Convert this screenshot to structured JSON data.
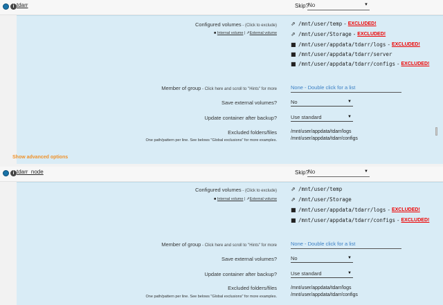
{
  "containers": [
    {
      "name": "tdarr",
      "skip_label": "Skip?",
      "skip_value": "No",
      "configured_volumes_label": "Configured volumes",
      "configured_volumes_hint": " - (Click to exclude)",
      "internal_volume_link": "Internal volume",
      "separator": " | ",
      "external_volume_link": "External volume",
      "volumes": [
        {
          "icon": "external-link-icon",
          "path": "/mnt/user/temp",
          "excluded": "EXCLUDED!"
        },
        {
          "icon": "external-link-icon",
          "path": "/mnt/user/Storage",
          "excluded": "EXCLUDED!"
        },
        {
          "icon": "folder-icon",
          "path": "/mnt/user/appdata/tdarr/logs",
          "excluded": "EXCLUDED!"
        },
        {
          "icon": "folder-icon",
          "path": "/mnt/user/appdata/tdarr/server",
          "excluded": ""
        },
        {
          "icon": "folder-icon",
          "path": "/mnt/user/appdata/tdarr/configs",
          "excluded": "EXCLUDED!"
        }
      ],
      "member_of_group_label": "Member of group",
      "member_click_here": "Click here",
      "member_hint": " and scroll to \"Hints\" for more",
      "member_value": "None - Double click for a list",
      "save_external_label": "Save external volumes?",
      "save_external_value": "No",
      "update_container_label": "Update container after backup?",
      "update_container_value": "Use standard",
      "excluded_folders_label": "Excluded folders/files",
      "excluded_folders_hint": "One path/pattern per line. See belows \"Global exclusions\" for more examples.",
      "excluded_folders_lines": [
        "/mnt/user/appdata/tdarr/logs",
        "/mnt/user/appdata/tdarr/configs"
      ],
      "show_advanced": "Show advanced options"
    },
    {
      "name": "tdarr_node",
      "skip_label": "Skip?",
      "skip_value": "No",
      "configured_volumes_label": "Configured volumes",
      "configured_volumes_hint": " - (Click to exclude)",
      "internal_volume_link": "Internal volume",
      "separator": " | ",
      "external_volume_link": "External volume",
      "volumes": [
        {
          "icon": "external-link-icon",
          "path": "/mnt/user/temp",
          "excluded": ""
        },
        {
          "icon": "external-link-icon",
          "path": "/mnt/user/Storage",
          "excluded": ""
        },
        {
          "icon": "folder-icon",
          "path": "/mnt/user/appdata/tdarr/logs",
          "excluded": "EXCLUDED!"
        },
        {
          "icon": "folder-icon",
          "path": "/mnt/user/appdata/tdarr/configs",
          "excluded": "EXCLUDED!"
        }
      ],
      "member_of_group_label": "Member of group",
      "member_click_here": "Click here",
      "member_hint": " and scroll to \"Hints\" for more",
      "member_value": "None - Double click for a list",
      "save_external_label": "Save external volumes?",
      "save_external_value": "No",
      "update_container_label": "Update container after backup?",
      "update_container_value": "Use standard",
      "excluded_folders_label": "Excluded folders/files",
      "excluded_folders_hint": "One path/pattern per line. See belows \"Global exclusions\" for more examples.",
      "excluded_folders_lines": [
        "/mnt/user/appdata/tdarr/logs",
        "/mnt/user/appdata/tdarr/configs"
      ]
    }
  ],
  "icons": {
    "toggle": "toggle-circle-icon",
    "info": "info-icon",
    "caret": "caret-down-icon"
  },
  "colors": {
    "panel_bg": "#d9ecf6",
    "excluded": "#ee0000",
    "accent_orange": "#f0922a",
    "link_blue": "#3b7fc4"
  }
}
